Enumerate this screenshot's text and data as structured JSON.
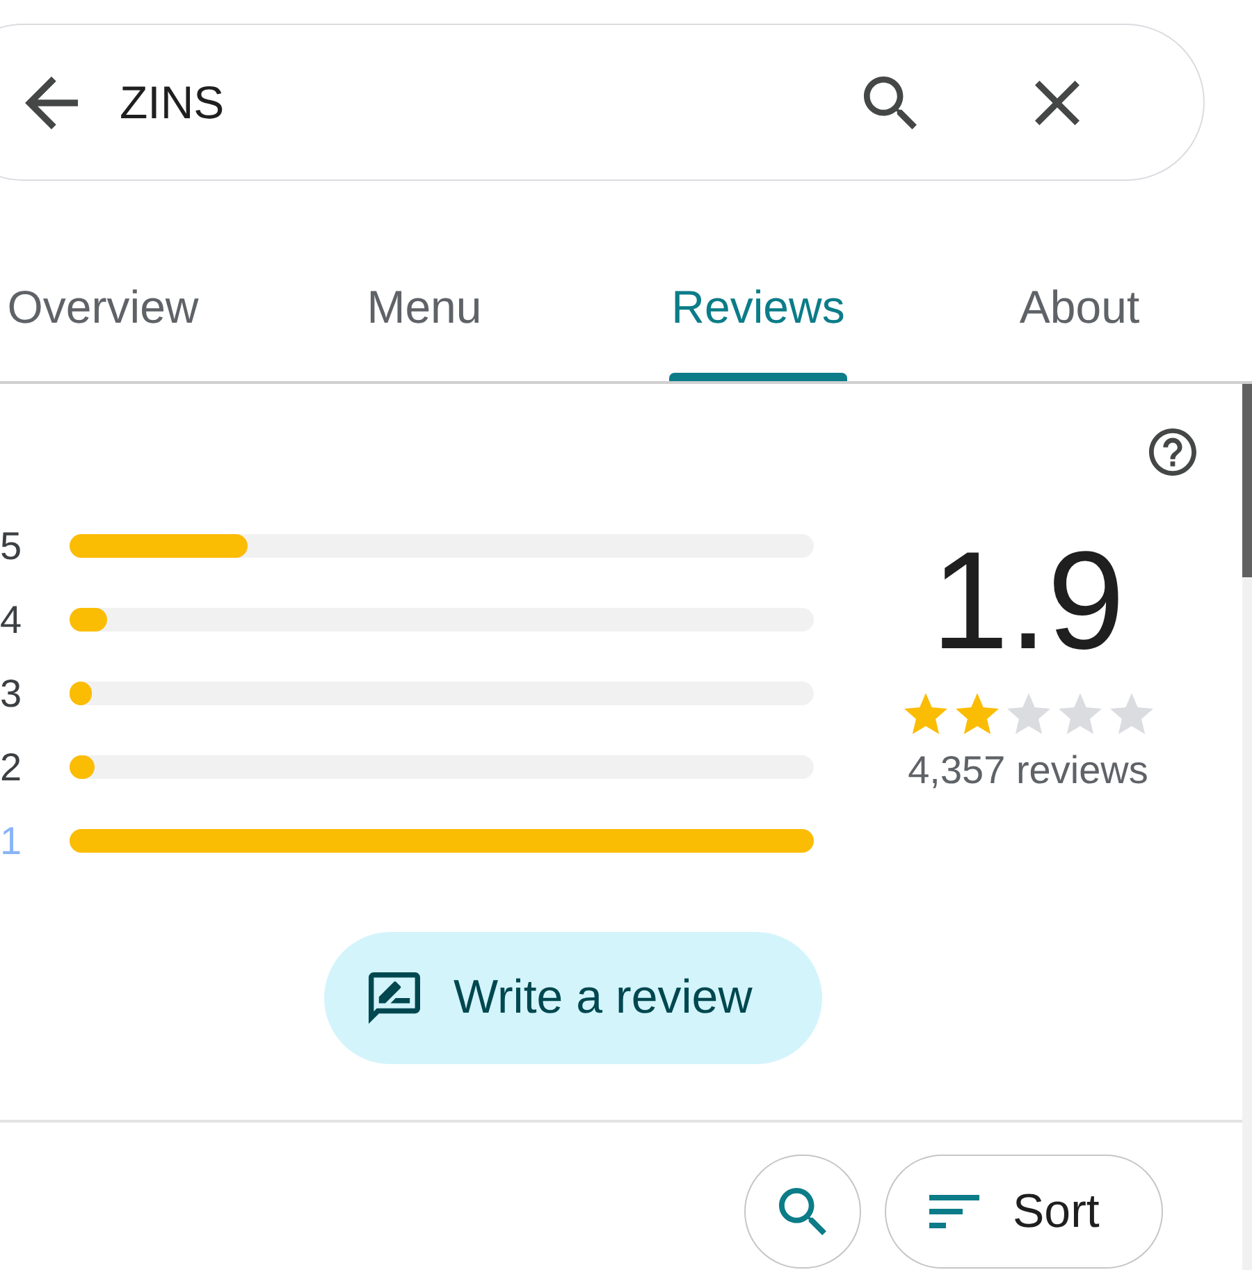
{
  "search": {
    "value": "ZINS"
  },
  "tabs": [
    {
      "label": "Overview",
      "selected": false
    },
    {
      "label": "Menu",
      "selected": false
    },
    {
      "label": "Reviews",
      "selected": true
    },
    {
      "label": "About",
      "selected": false
    }
  ],
  "rating_histogram": [
    {
      "label": "5",
      "level": 0.24,
      "selected": false
    },
    {
      "label": "4",
      "level": 0.05,
      "selected": false
    },
    {
      "label": "3",
      "level": 0.03,
      "selected": false
    },
    {
      "label": "2",
      "level": 0.034,
      "selected": false
    },
    {
      "label": "1",
      "level": 1,
      "selected": true
    }
  ],
  "summary": {
    "rating": "1.9",
    "stars": 2,
    "count": "4,357 reviews"
  },
  "write_review": {
    "label": "Write a review"
  },
  "sort": {
    "label": "Sort"
  }
}
